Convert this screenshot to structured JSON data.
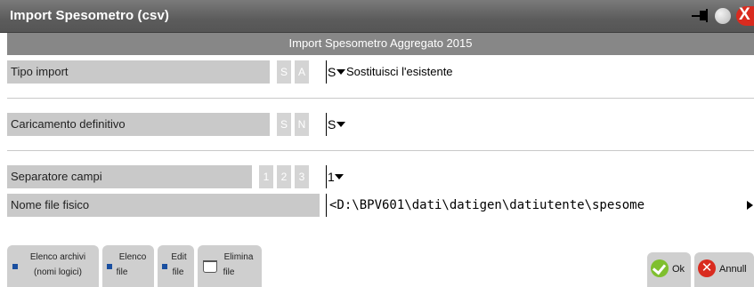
{
  "window": {
    "title": "Import Spesometro (csv)",
    "close_glyph": "X",
    "colors": {
      "titlebar": "#5c5c5c",
      "band": "#878787",
      "close": "#d92b1f",
      "ok": "#7fbf2e",
      "square_icon": "#1a4fa0"
    }
  },
  "band": {
    "text": "Import Spesometro Aggregato 2015"
  },
  "fields": {
    "tipo_import": {
      "label": "Tipo import",
      "options": [
        "S",
        "A"
      ],
      "value": "S",
      "description": "Sostituisci l'esistente"
    },
    "caricamento": {
      "label": "Caricamento definitivo",
      "options": [
        "S",
        "N"
      ],
      "value": "S"
    },
    "separatore": {
      "label": "Separatore campi",
      "options": [
        "1",
        "2",
        "3"
      ],
      "value": "1"
    },
    "nome_file": {
      "label": "Nome file fisico",
      "value": "<D:\\BPV601\\dati\\datigen\\datiutente\\spesome"
    }
  },
  "toolbar": {
    "elenco_archivi": {
      "line1": "Elenco archivi",
      "line2": "(nomi logici)",
      "icon": "blue-square-icon"
    },
    "elenco_file": {
      "line1": "Elenco",
      "line2": "file",
      "icon": "blue-square-icon"
    },
    "edit_file": {
      "line1": "Edit",
      "line2": "file",
      "icon": "blue-square-icon"
    },
    "elimina_file": {
      "line1": "Elimina",
      "line2": "file",
      "icon": "trash-bin-icon"
    },
    "ok": {
      "label": "Ok",
      "icon": "check-circle-icon"
    },
    "annulla": {
      "label": "Annull",
      "icon": "x-circle-icon"
    }
  }
}
